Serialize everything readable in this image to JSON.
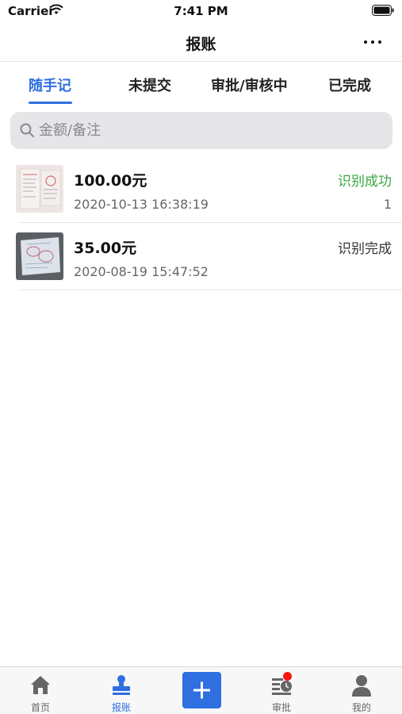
{
  "status_bar": {
    "carrier": "Carrier",
    "time": "7:41 PM"
  },
  "nav": {
    "title": "报账"
  },
  "tabs": [
    {
      "label": "随手记",
      "active": true
    },
    {
      "label": "未提交",
      "active": false
    },
    {
      "label": "审批/审核中",
      "active": false
    },
    {
      "label": "已完成",
      "active": false
    }
  ],
  "search": {
    "placeholder": "金额/备注",
    "value": ""
  },
  "items": [
    {
      "amount": "100.00元",
      "datetime": "2020-10-13 16:38:19",
      "status": "识别成功",
      "status_color": "#3aa845",
      "count": "1"
    },
    {
      "amount": "35.00元",
      "datetime": "2020-08-19 15:47:52",
      "status": "识别完成",
      "status_color": "#333333",
      "count": ""
    }
  ],
  "tab_bar": [
    {
      "label": "首页",
      "icon": "home-icon"
    },
    {
      "label": "报账",
      "icon": "stamp-icon",
      "active": true
    },
    {
      "label": "",
      "icon": "plus-icon"
    },
    {
      "label": "审批",
      "icon": "approval-clock-icon",
      "badge": true
    },
    {
      "label": "我的",
      "icon": "person-icon"
    }
  ],
  "colors": {
    "accent": "#2f6fe0",
    "success": "#3aa845",
    "badge": "#ff1111"
  }
}
